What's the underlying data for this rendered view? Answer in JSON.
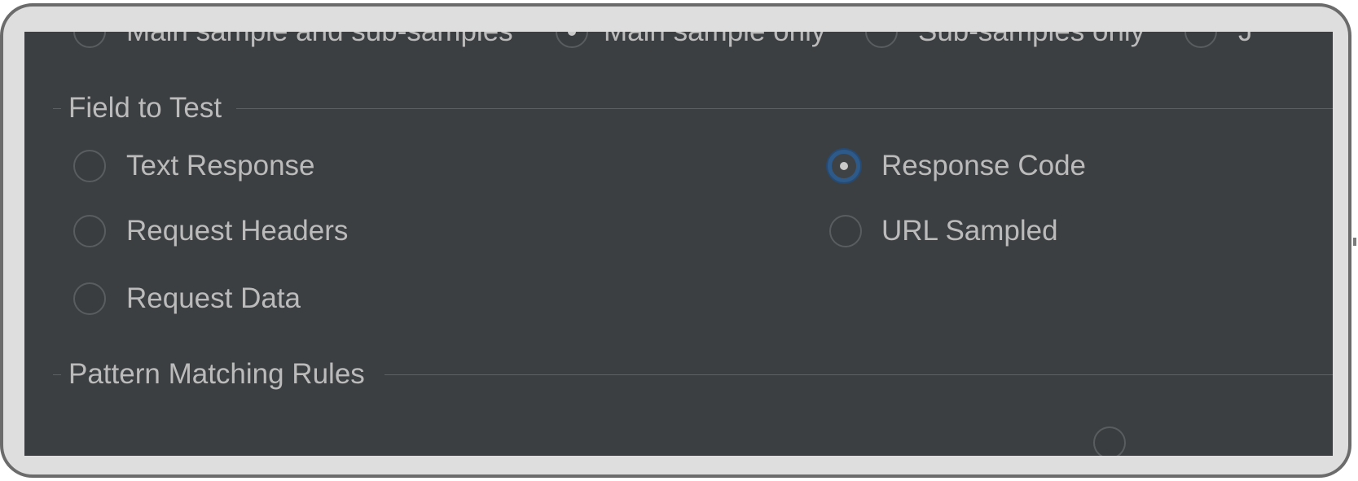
{
  "sample_scope": {
    "options": [
      {
        "label": "Main sample and sub-samples",
        "selected": false
      },
      {
        "label": "Main sample only",
        "selected": true
      },
      {
        "label": "Sub-samples only",
        "selected": false
      },
      {
        "label": "J",
        "selected": false
      }
    ]
  },
  "field_to_test": {
    "title": "Field to Test",
    "options": [
      {
        "label": "Text Response",
        "selected": false
      },
      {
        "label": "Response Code",
        "selected": true
      },
      {
        "label": "Request Headers",
        "selected": false
      },
      {
        "label": "URL Sampled",
        "selected": false
      },
      {
        "label": "Request Data",
        "selected": false
      }
    ]
  },
  "pattern_matching_rules": {
    "title": "Pattern Matching Rules"
  },
  "colors": {
    "panel_background": "#3c3f41",
    "frame_background": "#dedede",
    "text": "#bbbbbb",
    "selected_ring": "#2e5a8a"
  }
}
